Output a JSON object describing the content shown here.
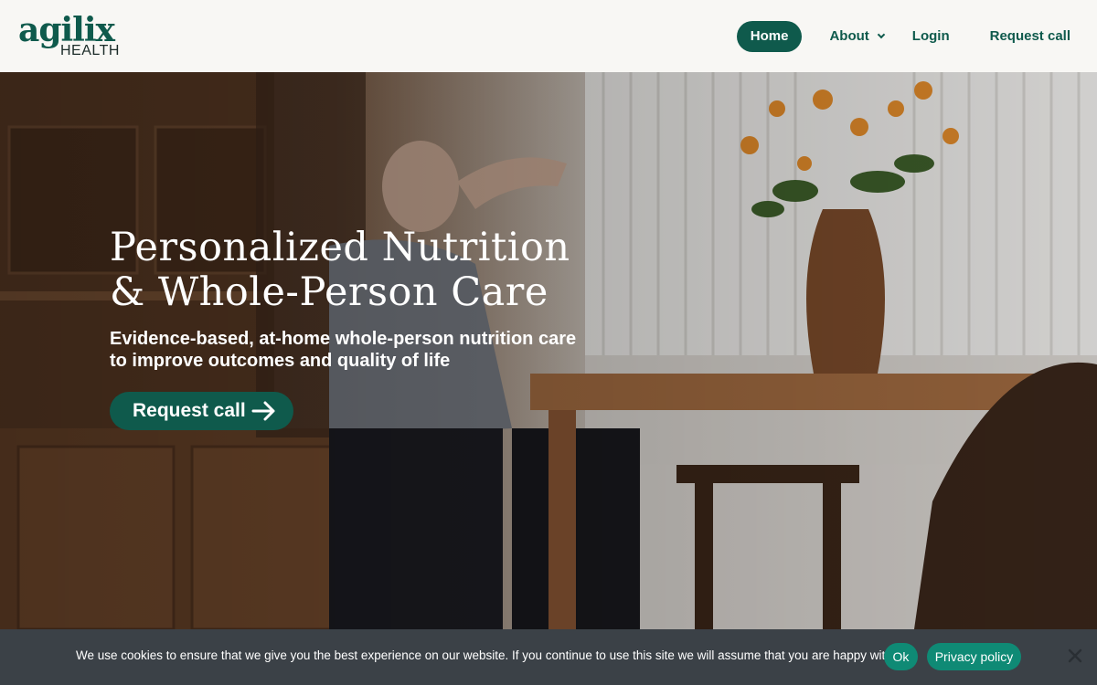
{
  "logo": {
    "wordmark": "agilix",
    "subtitle": "HEALTH"
  },
  "nav": {
    "items": [
      {
        "label": "Home",
        "active": true
      },
      {
        "label": "About",
        "has_dropdown": true
      },
      {
        "label": "Login"
      },
      {
        "label": "Request call"
      }
    ]
  },
  "hero": {
    "title_line1": "Personalized Nutrition",
    "title_line2": "& Whole-Person Care",
    "subtitle_line1": "Evidence-based, at-home whole-person nutrition care",
    "subtitle_line2": "to improve outcomes and quality of life",
    "cta_label": "Request call",
    "cta_icon": "arrow-right-icon"
  },
  "cookie_bar": {
    "message": "We use cookies to ensure that we give you the best experience on our website. If you continue to use this site we will assume that you are happy with it.",
    "ok_label": "Ok",
    "policy_label": "Privacy policy",
    "close_icon": "close-icon"
  },
  "colors": {
    "brand": "#0f5a4c",
    "header_bg": "#f8f7f4",
    "cookie_bg": "#3b4147",
    "cookie_button": "#0f8a75"
  }
}
